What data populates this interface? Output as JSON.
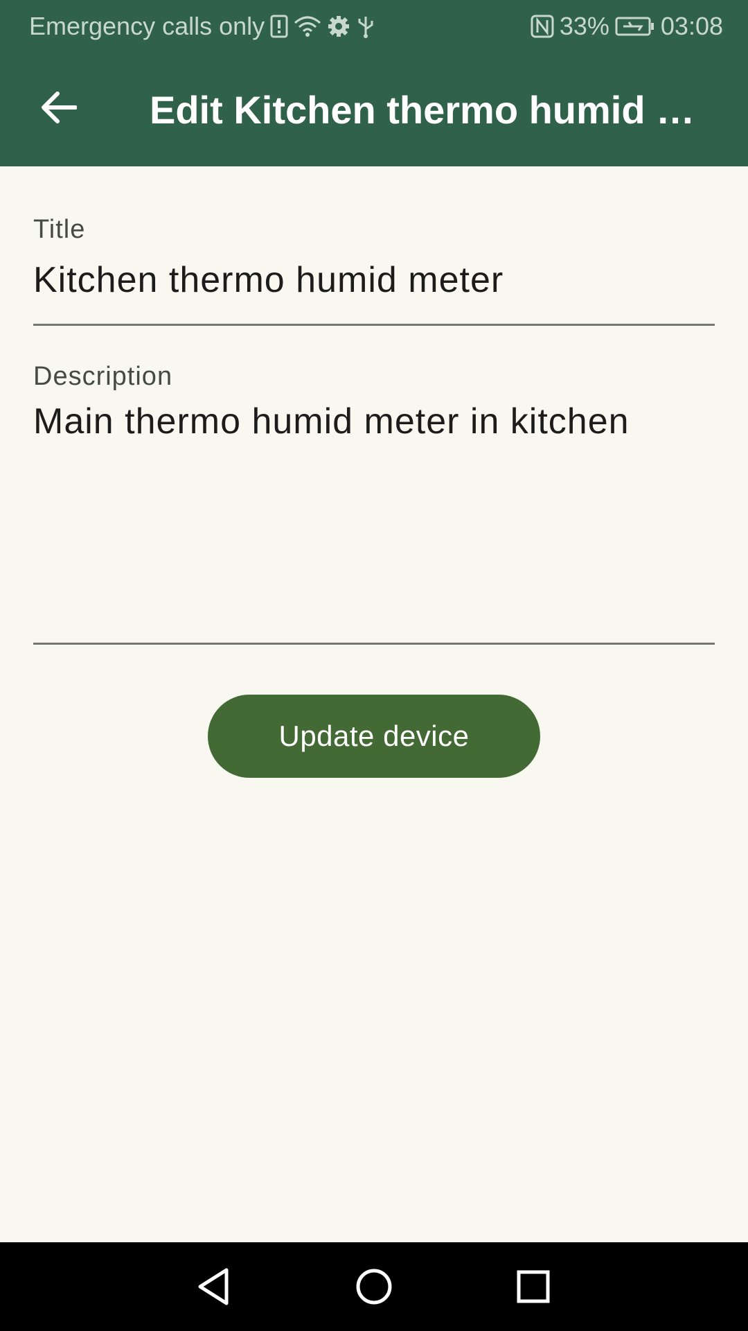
{
  "status_bar": {
    "carrier": "Emergency calls only",
    "battery": "33%",
    "time": "03:08",
    "icons": [
      "alert-icon",
      "wifi-icon",
      "settings-icon",
      "usb-icon",
      "nfc-icon",
      "battery-icon"
    ]
  },
  "app_bar": {
    "title": "Edit Kitchen thermo humid meter",
    "back_icon": "arrow-left-icon"
  },
  "form": {
    "title_label": "Title",
    "title_value": "Kitchen thermo humid meter",
    "description_label": "Description",
    "description_value": "Main thermo humid meter in kitchen"
  },
  "actions": {
    "update_label": "Update device"
  },
  "nav": {
    "icons": [
      "back-triangle-icon",
      "home-circle-icon",
      "recents-square-icon"
    ]
  },
  "colors": {
    "app_bar": "#30614a",
    "button": "#436935",
    "background": "#f8f8f1"
  }
}
